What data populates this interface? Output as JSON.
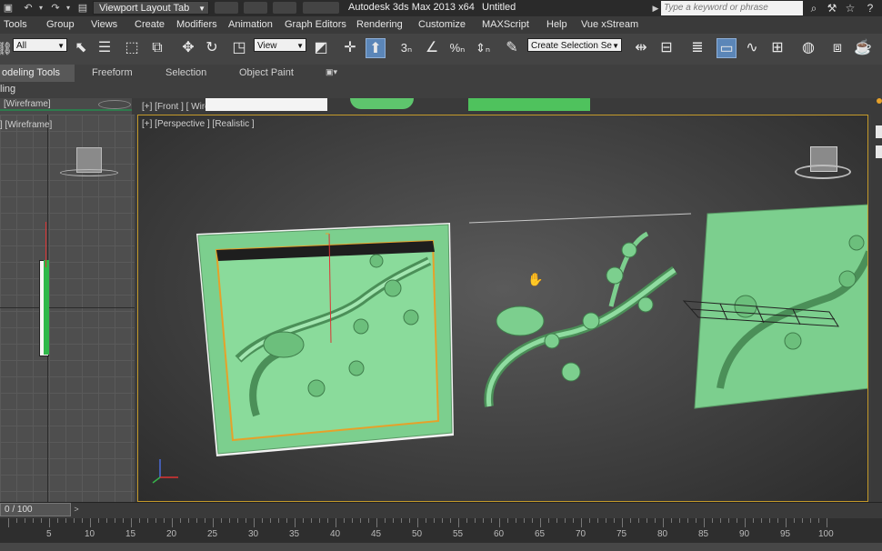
{
  "titlebar": {
    "workspace": "Viewport Layout Tab",
    "app_title": "Autodesk 3ds Max  2013 x64",
    "doc_title": "Untitled",
    "search_placeholder": "Type a keyword or phrase"
  },
  "menu": [
    "Tools",
    "Group",
    "Views",
    "Create",
    "Modifiers",
    "Animation",
    "Graph Editors",
    "Rendering",
    "Customize",
    "MAXScript",
    "Help",
    "Vue xStream"
  ],
  "toolbar": {
    "filter_value": "All",
    "refcoord_value": "View",
    "selection_set_placeholder": "Create Selection Se"
  },
  "ribbon": {
    "tabs": [
      "odeling Tools",
      "Freeform",
      "Selection",
      "Object Paint"
    ],
    "subtab": "ling"
  },
  "viewports": {
    "left_label": "] [Wireframe]",
    "left_top_label": "[Wireframe]",
    "top_strip_label": "[+] [Front ] [ Wireframe ]",
    "persp_label": "[+] [Perspective ] [Realistic ]"
  },
  "timeline": {
    "frame": "0 / 100",
    "ticks": [
      "5",
      "10",
      "15",
      "20",
      "25",
      "30",
      "35",
      "40",
      "45",
      "50",
      "55",
      "60",
      "65",
      "70",
      "75",
      "80",
      "85",
      "90",
      "95",
      "100"
    ]
  },
  "colors": {
    "accent": "#5b86b8",
    "viewport_border": "#c49a2a",
    "model": "#7ccf8e"
  }
}
